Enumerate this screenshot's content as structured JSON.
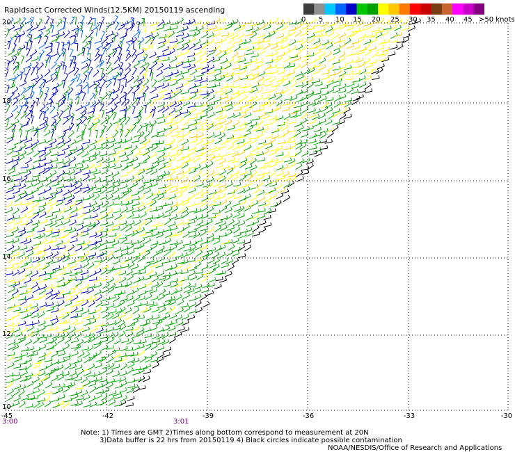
{
  "title": "Rapidsact Corrected Winds(12.5KM) 20150119 ascending",
  "legend": {
    "labels": [
      "0",
      "5",
      "10",
      "15",
      "20",
      "25",
      "30",
      "35",
      "40",
      "45",
      ">50 knots"
    ],
    "colors": [
      "#3c3c3c",
      "#909090",
      "#00c8ff",
      "#0064ff",
      "#0000c8",
      "#00c800",
      "#00a000",
      "#ffff00",
      "#ffc800",
      "#ff7800",
      "#ff0000",
      "#c80000",
      "#783c14",
      "#c86432",
      "#ff00ff",
      "#c800c8",
      "#800080"
    ]
  },
  "lat_labels": [
    "20",
    "18",
    "16",
    "14",
    "12",
    "10"
  ],
  "lon_labels": [
    "-45",
    "-42",
    "-39",
    "-36",
    "-33",
    "-30"
  ],
  "time_labels": [
    "3:00",
    "3:01"
  ],
  "notes": [
    "Note: 1) Times are GMT 2)Times along bottom correspond to measurement at 20N",
    "3)Data buffer is 22 hrs from 20150119 4) Black circles indicate possible contamination",
    "NOAA/NESDIS/Office of Research and Applications"
  ],
  "map_extent": {
    "lat_min": 10,
    "lat_max": 20,
    "lon_min": -45,
    "lon_max": -30
  }
}
